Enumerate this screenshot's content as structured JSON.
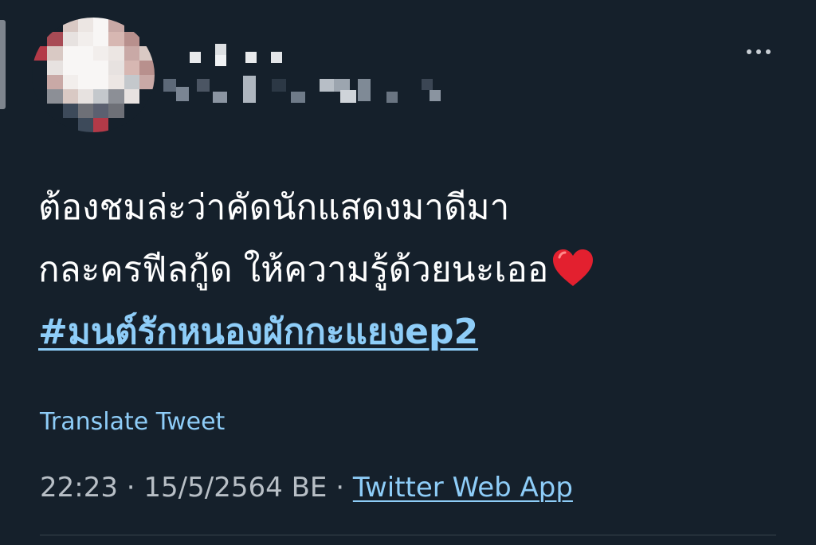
{
  "tweet": {
    "lines": [
      "ต้องชมล่ะว่าคัดนักแสดงมาดีมา",
      "กละครฟีลกู้ด ให้ความรู้ด้วยนะเออ"
    ],
    "emoji": "heart-icon",
    "hashtag": "#มนต์รักหนองผักกะแยงep2"
  },
  "translate_label": "Translate Tweet",
  "meta": {
    "time": "22:23",
    "separator": "·",
    "date": "15/5/2564 BE",
    "source": "Twitter Web App"
  },
  "colors": {
    "background": "#15202b",
    "link": "#8ecdf8",
    "muted_text": "#b8bfc6",
    "divider": "#38444d"
  }
}
